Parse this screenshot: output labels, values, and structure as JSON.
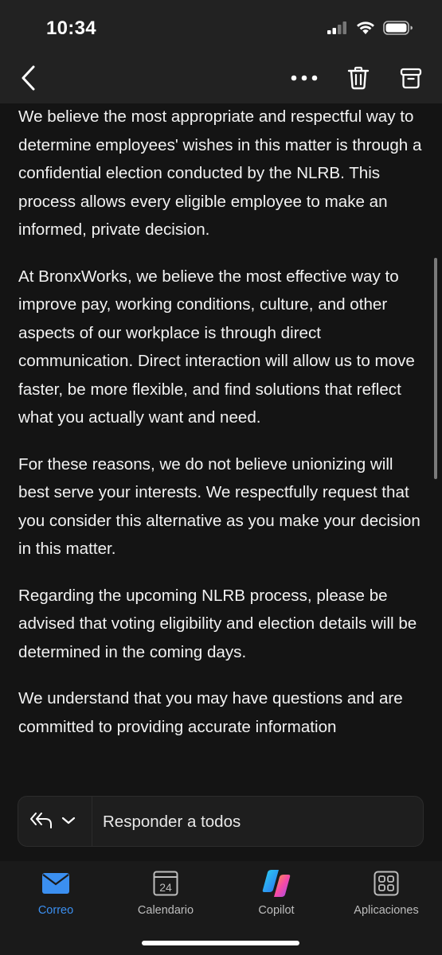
{
  "status_bar": {
    "time": "10:34",
    "icons": [
      "cellular-signal-icon",
      "wifi-icon",
      "battery-icon"
    ]
  },
  "nav": {
    "back_icon": "chevron-left-icon",
    "more_icon": "more-horizontal-icon",
    "delete_icon": "trash-icon",
    "archive_icon": "archive-icon"
  },
  "message": {
    "paragraphs": [
      "We believe the most appropriate and respectful way to determine employees' wishes in this matter is through a confidential election conducted by the NLRB. This process allows every eligible employee to make an informed, private decision.",
      "At BronxWorks, we believe the most effective way to improve pay, working conditions, culture, and other aspects of our workplace is through direct communication. Direct interaction will allow us to move faster, be more flexible, and find solutions that reflect what you actually want and need.",
      "For these reasons, we do not believe unionizing will best serve your interests. We respectfully request that you consider this alternative as you make your decision in this matter.",
      "Regarding the upcoming NLRB process, please be advised that voting eligibility and election details will be determined in the coming days.",
      "We understand that you may have questions and are committed to providing accurate information"
    ]
  },
  "reply": {
    "label": "Responder a todos",
    "icon": "reply-all-icon",
    "dropdown_icon": "chevron-down-icon"
  },
  "tabs": [
    {
      "label": "Correo",
      "icon": "mail-icon",
      "active": true
    },
    {
      "label": "Calendario",
      "icon": "calendar-icon",
      "day": "24",
      "active": false
    },
    {
      "label": "Copilot",
      "icon": "copilot-icon",
      "active": false
    },
    {
      "label": "Aplicaciones",
      "icon": "apps-grid-icon",
      "active": false
    }
  ],
  "colors": {
    "accent": "#3b8ff0",
    "background": "#141414",
    "bars": "#222222"
  }
}
